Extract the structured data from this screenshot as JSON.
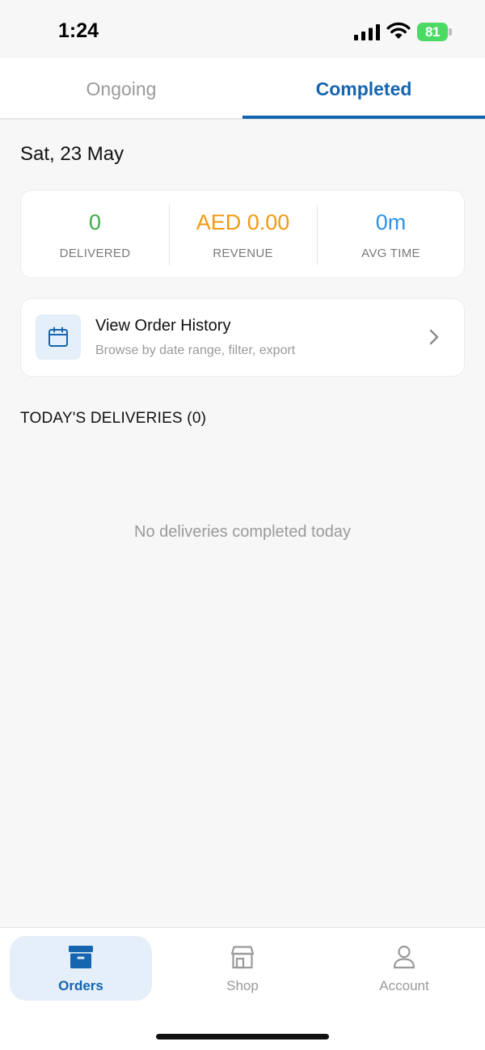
{
  "status_bar": {
    "time": "1:24",
    "battery": "81"
  },
  "tabs": [
    {
      "label": "Ongoing",
      "active": false
    },
    {
      "label": "Completed",
      "active": true
    }
  ],
  "date_heading": "Sat, 23 May",
  "stats": {
    "delivered": {
      "value": "0",
      "label": "DELIVERED",
      "color": "#3cac4a"
    },
    "revenue": {
      "value": "AED 0.00",
      "label": "REVENUE",
      "color": "#f29a12"
    },
    "avg_time": {
      "value": "0m",
      "label": "AVG TIME",
      "color": "#2c93e6"
    }
  },
  "order_history": {
    "title": "View Order History",
    "subtitle": "Browse by date range, filter, export",
    "icon": "calendar-icon"
  },
  "deliveries_section": {
    "title": "TODAY'S DELIVERIES (0)",
    "empty_text": "No deliveries completed today"
  },
  "bottom_nav": [
    {
      "label": "Orders",
      "icon": "archive-box-icon",
      "active": true
    },
    {
      "label": "Shop",
      "icon": "store-icon",
      "active": false
    },
    {
      "label": "Account",
      "icon": "user-icon",
      "active": false
    }
  ],
  "colors": {
    "accent": "#1565b0",
    "muted": "#9a9a9a",
    "background": "#f7f7f7"
  }
}
